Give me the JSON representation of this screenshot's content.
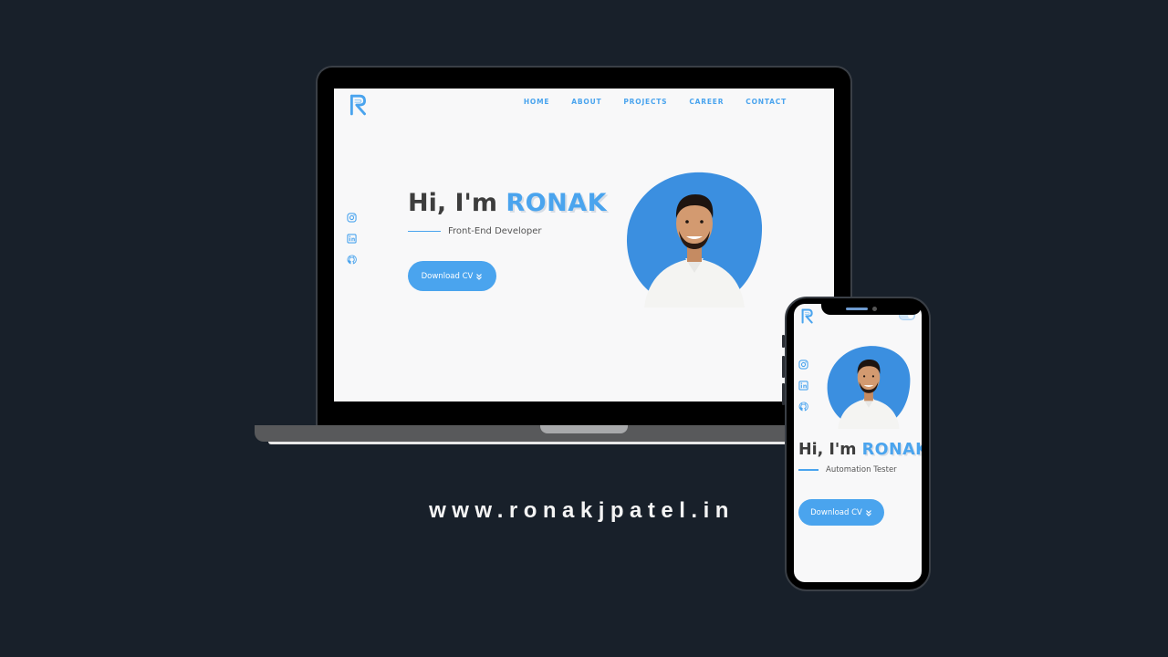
{
  "colors": {
    "accent": "#4aa4ee",
    "background": "#18202a",
    "screen": "#f8f8f9",
    "text": "#3d3d3d"
  },
  "laptop": {
    "nav": [
      "HOME",
      "ABOUT",
      "PROJECTS",
      "CAREER",
      "CONTACT"
    ],
    "greeting": "Hi, I'm",
    "name": "RONAK",
    "role": "Front-End Developer",
    "cta": "Download CV",
    "social_icons": [
      "instagram-icon",
      "linkedin-icon",
      "github-icon"
    ]
  },
  "phone": {
    "greeting": "Hi, I'm",
    "name": "RONAK",
    "role": "Automation Tester",
    "cta": "Download CV",
    "social_icons": [
      "instagram-icon",
      "linkedin-icon",
      "github-icon"
    ]
  },
  "website_url": "www.ronakjpatel.in"
}
